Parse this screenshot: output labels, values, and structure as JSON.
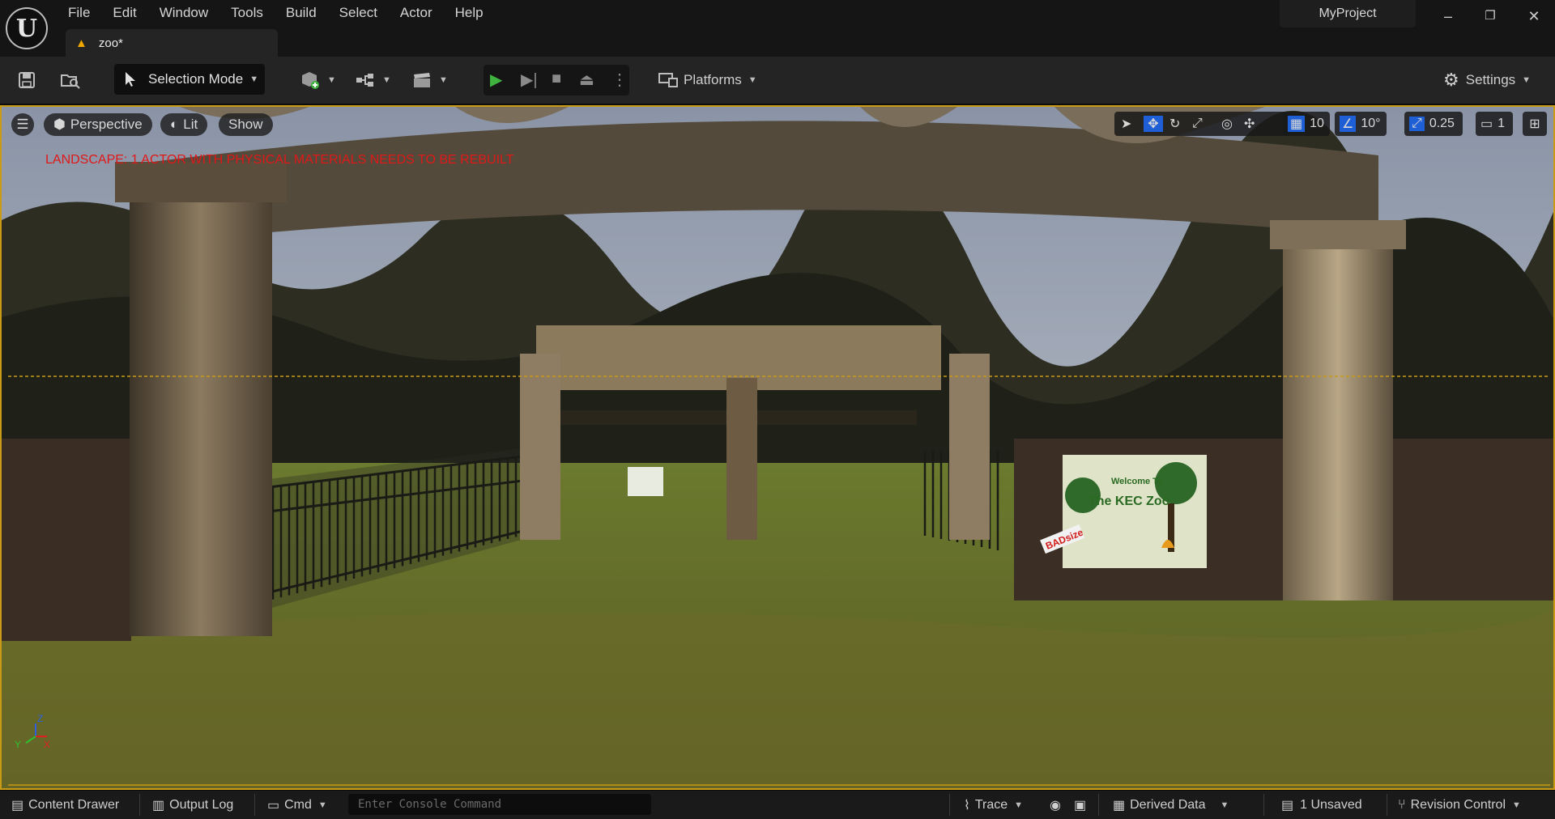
{
  "menu": [
    "File",
    "Edit",
    "Window",
    "Tools",
    "Build",
    "Select",
    "Actor",
    "Help"
  ],
  "document_tab": "zoo*",
  "project_name": "MyProject",
  "window_controls": {
    "minimize": "–",
    "restore": "❐",
    "close": "✕"
  },
  "toolbar": {
    "selection_mode": "Selection Mode",
    "platforms": "Platforms",
    "settings": "Settings"
  },
  "viewport": {
    "perspective": "Perspective",
    "lit": "Lit",
    "show": "Show",
    "grid_snap": "10",
    "rotation_snap": "10°",
    "scale_snap": "0.25",
    "camera_speed": "1",
    "warning": "LANDSCAPE: 1 ACTOR WITH PHYSICAL MATERIALS NEEDS TO BE REBUILT",
    "sign_line1": "Welcome To",
    "sign_line2": "The KEC Zoo",
    "sticker": "BADsize",
    "axis_z": "Z",
    "axis_y": "Y",
    "axis_x": "X"
  },
  "statusbar": {
    "content_drawer": "Content Drawer",
    "output_log": "Output Log",
    "cmd": "Cmd",
    "console_placeholder": "Enter Console Command",
    "trace": "Trace",
    "derived_data": "Derived Data",
    "unsaved": "1 Unsaved",
    "revision_control": "Revision Control"
  },
  "colors": {
    "accent_yellow": "#c89a16",
    "warning_red": "#e01818",
    "play_green": "#3fb23f",
    "active_blue": "#1f5fd6"
  }
}
